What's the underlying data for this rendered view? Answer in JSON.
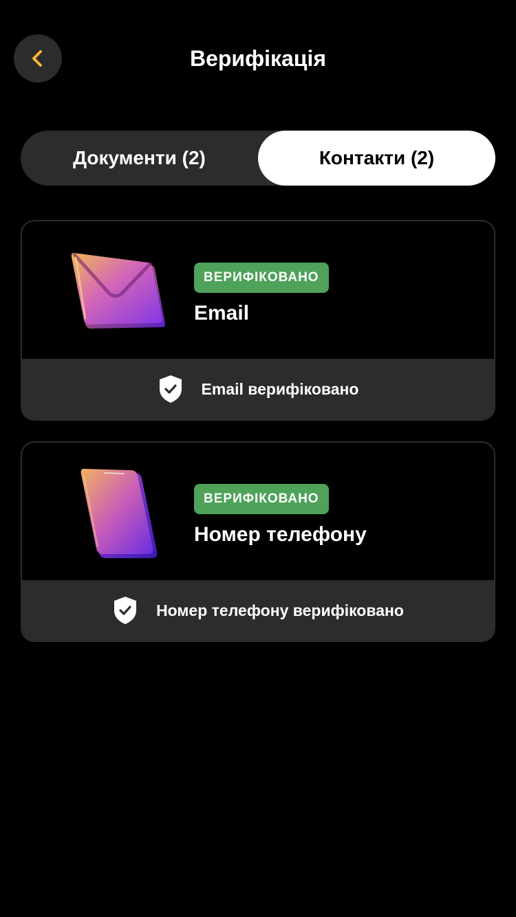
{
  "header": {
    "title": "Верифікація",
    "back_icon": "chevron-left-icon",
    "accent_color": "#f5b731"
  },
  "tabs": [
    {
      "label": "Документи (2)",
      "selected": false
    },
    {
      "label": "Контакти (2)",
      "selected": true
    }
  ],
  "cards": [
    {
      "icon": "envelope-icon",
      "badge": "ВЕРИФІКОВАНО",
      "title": "Email",
      "footer_icon": "shield-check-icon",
      "footer_text": "Email верифіковано"
    },
    {
      "icon": "smartphone-icon",
      "badge": "ВЕРИФІКОВАНО",
      "title": "Номер телефону",
      "footer_icon": "shield-check-icon",
      "footer_text": "Номер телефону верифіковано"
    }
  ],
  "colors": {
    "background": "#000000",
    "surface": "#2c2c2e",
    "badge": "#4ea25a",
    "selected_tab": "#ffffff"
  }
}
